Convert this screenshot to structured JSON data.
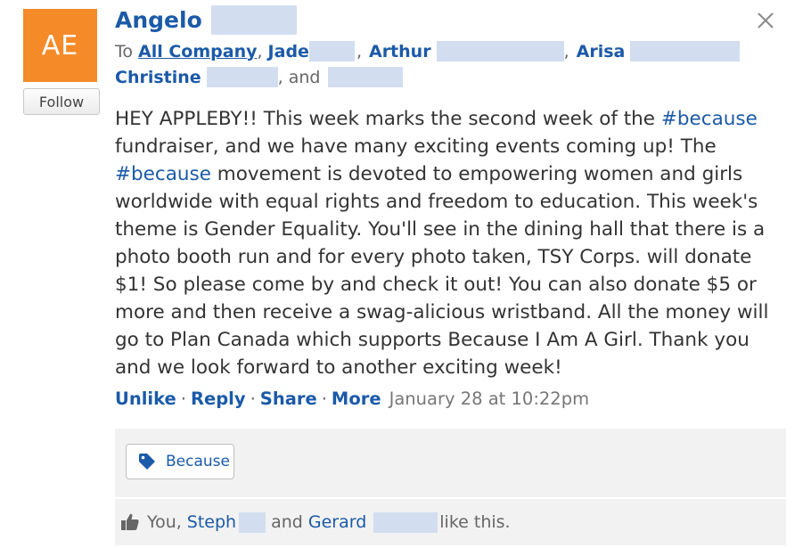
{
  "avatar": {
    "initials": "AE",
    "color": "#f58a29"
  },
  "follow_label": "Follow",
  "author": {
    "name": "Angelo"
  },
  "close_icon": "close-icon",
  "recipients": {
    "to_label": "To",
    "group": "All Company",
    "sep": ",",
    "r1": "Jade",
    "r2": "Arthur",
    "r3": "Arisa",
    "r4": "Christine",
    "and_label": ", and"
  },
  "message": {
    "p1": "HEY APPLEBY!! This week marks the second week of the ",
    "hashtag1": "#because",
    "p2": " fundraiser, and we have many exciting events coming up! The ",
    "hashtag2": "#because",
    "p3": " movement is devoted to empowering women and girls worldwide with equal rights and freedom to education. This week's theme is Gender Equality. You'll see in the dining hall that there is a photo booth run and for every photo taken, TSY Corps. will donate $1! So please come by and check it out! You can also donate $5 or more and then receive a swag-alicious wristband. All the money will go to Plan Canada which supports Because I Am A Girl. Thank you and we look forward to another exciting week!"
  },
  "actions": {
    "unlike": "Unlike",
    "reply": "Reply",
    "share": "Share",
    "more": "More",
    "dot": "·",
    "timestamp": "January 28 at 10:22pm"
  },
  "topic": {
    "label": "Because",
    "icon": "tag-icon"
  },
  "likes": {
    "icon": "thumbs-up-icon",
    "you": "You,",
    "person1": "Steph",
    "and": "and",
    "person2": "Gerard",
    "suffix": "like this."
  },
  "colors": {
    "link": "#1b5aa8",
    "panel": "#f2f2f2",
    "redacted": "#d2def0"
  }
}
